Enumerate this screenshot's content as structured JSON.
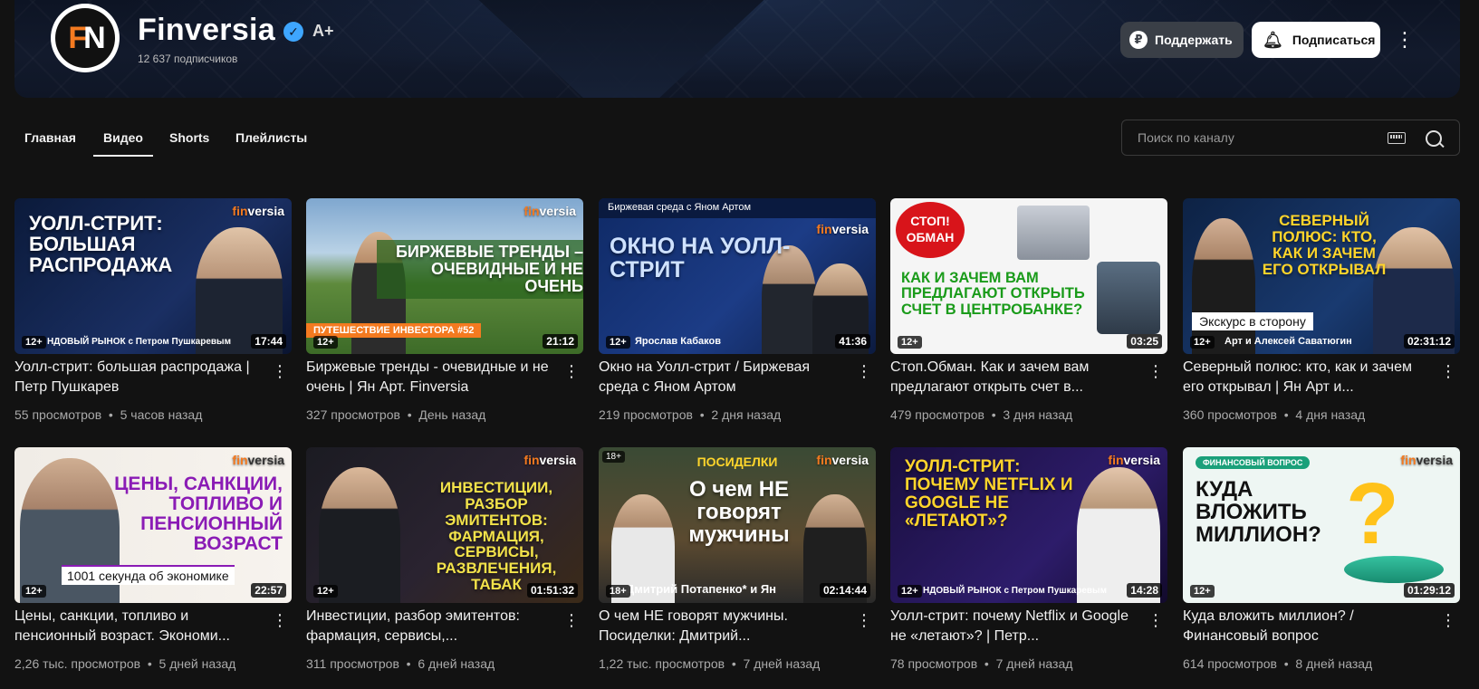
{
  "channel": {
    "name": "Finversia",
    "subscribers": "12 637 подписчиков",
    "logo_letters": [
      "F",
      "N"
    ],
    "badge": "A+",
    "support_label": "Поддержать",
    "subscribe_label": "Подписаться"
  },
  "tabs": [
    "Главная",
    "Видео",
    "Shorts",
    "Плейлисты"
  ],
  "active_tab": "Видео",
  "search": {
    "placeholder": "Поиск по каналу"
  },
  "videos": [
    {
      "title": "Уолл-стрит: большая распродажа | Петр Пушкарев",
      "views": "55 просмотров",
      "age": "5 часов назад",
      "duration": "17:44",
      "rating": "12+",
      "thumb_text": "УОЛЛ-СТРИТ: БОЛЬШАЯ РАСПРОДАЖА",
      "thumb_footer": "НДОВЫЙ РЫНОК с Петром Пушкаревым"
    },
    {
      "title": "Биржевые тренды - очевидные и не очень | Ян Арт. Finversia",
      "views": "327 просмотров",
      "age": "День назад",
      "duration": "21:12",
      "rating": "12+",
      "thumb_text": "БИРЖЕВЫЕ ТРЕНДЫ – ОЧЕВИДНЫЕ И НЕ ОЧЕНЬ",
      "thumb_footer": "ПУТЕШЕСТВИЕ ИНВЕСТОРА #52"
    },
    {
      "title": "Окно на Уолл-стрит / Биржевая среда с Яном Артом",
      "views": "219 просмотров",
      "age": "2 дня назад",
      "duration": "41:36",
      "rating": "12+",
      "thumb_text": "ОКНО НА УОЛЛ-СТРИТ",
      "thumb_header": "Биржевая среда с Яном Артом",
      "thumb_footer": "Ярослав Кабаков"
    },
    {
      "title": "Стоп.Обман. Как и зачем вам предлагают открыть счет в...",
      "views": "479 просмотров",
      "age": "3 дня назад",
      "duration": "03:25",
      "rating": "12+",
      "thumb_text": "КАК И ЗАЧЕМ ВАМ ПРЕДЛАГАЮТ ОТКРЫТЬ СЧЕТ В ЦЕНТРОБАНКЕ?",
      "thumb_header": "СТОП! ОБМАН"
    },
    {
      "title": "Северный полюс: кто, как и зачем его открывал | Ян Арт и...",
      "views": "360 просмотров",
      "age": "4 дня назад",
      "duration": "02:31:12",
      "rating": "12+",
      "thumb_text": "СЕВЕРНЫЙ ПОЛЮС: КТО, КАК И ЗАЧЕМ ЕГО ОТКРЫВАЛ",
      "thumb_footer": "Экскурс в сторону",
      "thumb_footer2": "Арт и Алексей Саватюгин"
    },
    {
      "title": "Цены, санкции, топливо и пенсионный возраст. Экономи...",
      "views": "2,26 тыс. просмотров",
      "age": "5 дней назад",
      "duration": "22:57",
      "rating": "12+",
      "thumb_text": "ЦЕНЫ, САНКЦИИ, ТОПЛИВО И ПЕНСИОННЫЙ ВОЗРАСТ",
      "thumb_footer": "1001 секунда об экономике"
    },
    {
      "title": "Инвестиции, разбор эмитентов: фармация, сервисы,...",
      "views": "311 просмотров",
      "age": "6 дней назад",
      "duration": "01:51:32",
      "rating": "12+",
      "thumb_text": "ИНВЕСТИЦИИ, РАЗБОР ЭМИТЕНТОВ: ФАРМАЦИЯ, СЕРВИСЫ, РАЗВЛЕЧЕНИЯ, ТАБАК"
    },
    {
      "title": "О чем НЕ говорят мужчины. Посиделки: Дмитрий...",
      "views": "1,22 тыс. просмотров",
      "age": "7 дней назад",
      "duration": "02:14:44",
      "rating": "18+",
      "thumb_text": "О чем НЕ говорят мужчины",
      "thumb_header": "ПОСИДЕЛКИ",
      "thumb_footer": "Дмитрий Потапенко* и Ян"
    },
    {
      "title": "Уолл-стрит: почему Netflix и Google не «летают»? | Петр...",
      "views": "78 просмотров",
      "age": "7 дней назад",
      "duration": "14:28",
      "rating": "12+",
      "thumb_text": "УОЛЛ-СТРИТ: ПОЧЕМУ NETFLIX И GOOGLE НЕ «ЛЕТАЮТ»?",
      "thumb_footer": "НДОВЫЙ РЫНОК с Петром Пушкаревым"
    },
    {
      "title": "Куда вложить миллион? / Финансовый вопрос",
      "views": "614 просмотров",
      "age": "8 дней назад",
      "duration": "01:29:12",
      "rating": "12+",
      "thumb_text": "КУДА ВЛОЖИТЬ МИЛЛИОН?",
      "thumb_header": "ФИНАНСОВЫЙ ВОПРОС"
    }
  ],
  "brand_watermark": "finversia",
  "colors": {
    "brand_orange": "#f47a20",
    "background": "#121212",
    "accent_blue": "#3ea6ff"
  }
}
